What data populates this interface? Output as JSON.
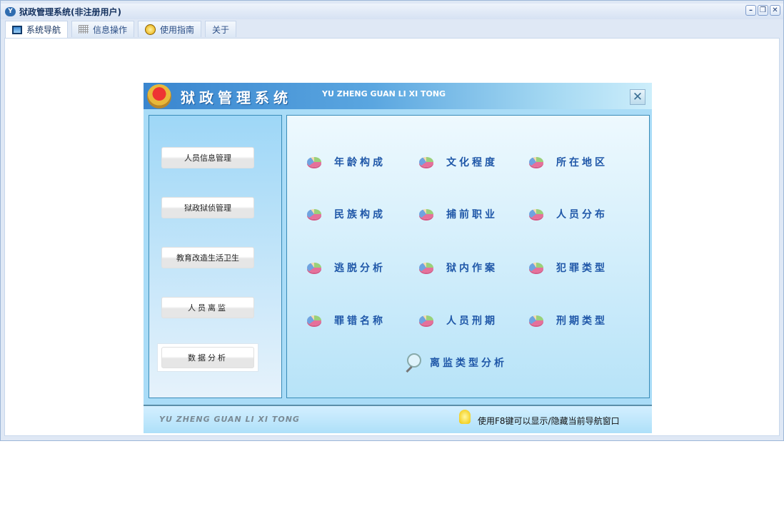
{
  "window": {
    "title": "狱政管理系统(非注册用户)",
    "controls": [
      "minimize",
      "restore",
      "close"
    ]
  },
  "tabs": [
    {
      "label": "系统导航",
      "icon": "monitor-icon"
    },
    {
      "label": "信息操作",
      "icon": "grid-icon"
    },
    {
      "label": "使用指南",
      "icon": "help-icon"
    },
    {
      "label": "关于"
    }
  ],
  "dialog": {
    "title": "狱政管理系统",
    "subtitle": "YU ZHENG GUAN LI XI TONG",
    "sidebar": [
      "人员信息管理",
      "狱政狱侦管理",
      "教育改造生活卫生",
      "人员离监",
      "数据分析"
    ],
    "selected_sidebar": "数据分析",
    "items": [
      "年龄构成",
      "文化程度",
      "所在地区",
      "民族构成",
      "捕前职业",
      "人员分布",
      "逃脱分析",
      "狱内作案",
      "犯罪类型",
      "罪错名称",
      "人员刑期",
      "刑期类型"
    ],
    "bottom_item": "离监类型分析",
    "footer_left": "YU ZHENG GUAN LI XI TONG",
    "footer_hint": "使用F8键可以显示/隐藏当前导航窗口"
  }
}
